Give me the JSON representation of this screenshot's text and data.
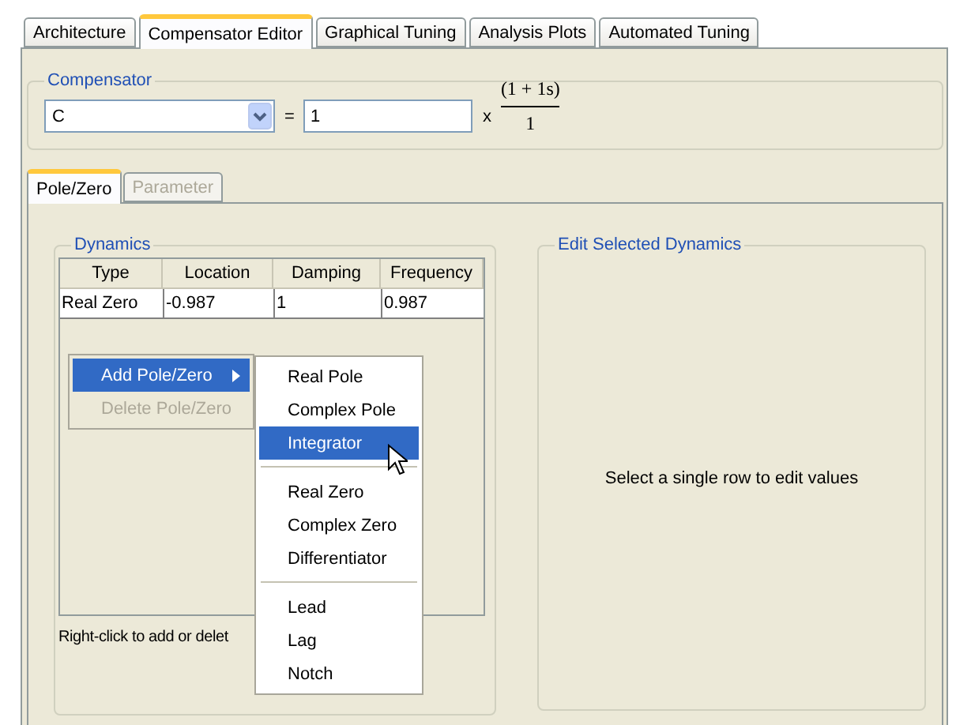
{
  "tabs": [
    {
      "label": "Architecture",
      "selected": false
    },
    {
      "label": "Compensator Editor",
      "selected": true
    },
    {
      "label": "Graphical Tuning",
      "selected": false
    },
    {
      "label": "Analysis Plots",
      "selected": false
    },
    {
      "label": "Automated Tuning",
      "selected": false
    }
  ],
  "compensator": {
    "title": "Compensator",
    "select_value": "C",
    "equals": "=",
    "gain_value": "1",
    "times": "x",
    "numerator": "(1 + 1s)",
    "denominator": "1"
  },
  "subtabs": [
    {
      "label": "Pole/Zero",
      "selected": true,
      "disabled": false
    },
    {
      "label": "Parameter",
      "selected": false,
      "disabled": true
    }
  ],
  "dynamics": {
    "title": "Dynamics",
    "columns": [
      "Type",
      "Location",
      "Damping",
      "Frequency"
    ],
    "rows": [
      [
        "Real Zero",
        "-0.987",
        "1",
        "0.987"
      ]
    ],
    "hint": "Right-click to add or delet"
  },
  "context_menu": [
    {
      "label": "Add Pole/Zero",
      "selected": true,
      "disabled": false,
      "submenu": true
    },
    {
      "label": "Delete Pole/Zero",
      "selected": false,
      "disabled": true,
      "submenu": false
    }
  ],
  "submenu": [
    {
      "kind": "item",
      "label": "Real Pole",
      "selected": false
    },
    {
      "kind": "item",
      "label": "Complex Pole",
      "selected": false
    },
    {
      "kind": "item",
      "label": "Integrator",
      "selected": true
    },
    {
      "kind": "separator"
    },
    {
      "kind": "item",
      "label": "Real Zero",
      "selected": false
    },
    {
      "kind": "item",
      "label": "Complex Zero",
      "selected": false
    },
    {
      "kind": "item",
      "label": "Differentiator",
      "selected": false
    },
    {
      "kind": "separator"
    },
    {
      "kind": "item",
      "label": "Lead",
      "selected": false
    },
    {
      "kind": "item",
      "label": "Lag",
      "selected": false
    },
    {
      "kind": "item",
      "label": "Notch",
      "selected": false
    }
  ],
  "edit_panel": {
    "title": "Edit Selected Dynamics",
    "message": "Select a single row to edit values"
  }
}
